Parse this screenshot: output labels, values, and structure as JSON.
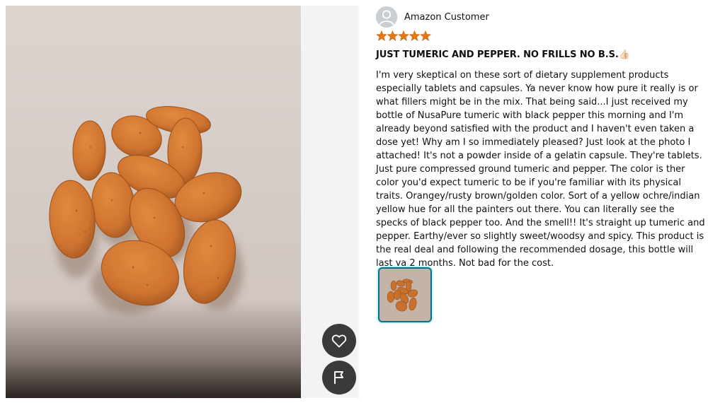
{
  "review": {
    "reviewer_name": "Amazon Customer",
    "rating": 5,
    "rating_max": 5,
    "title": "JUST TUMERIC AND PEPPER. NO FRILLS NO B.S.",
    "title_emoji": "👍🏻",
    "body": "I'm very skeptical on these sort of dietary supplement products especially tablets and capsules. Ya never know how pure it really is or what fillers might be in the mix. That being said...I just received my bottle of NusaPure tumeric with black pepper this morning and I'm already beyond satisfied with the product and I haven't even taken a dose yet! Why am I so immediately pleased? Just look at the photo I attached! It's not a powder inside of a gelatin capsule. They're tablets. Just pure compressed ground tumeric and pepper. The color is ther color you'd expect tumeric to be if you're familiar with its physical traits. Orangey/rusty brown/golden color. Sort of a yellow ochre/indian yellow hue for all the painters out there. You can literally see the specks of black pepper too. And the smell!! It's straight up tumeric and pepper. Earthy/ever so slightly sweet/woodsy and spicy. This product is the real deal and following the recommended dosage, this bottle will last ya 2 months. Not bad for the cost."
  },
  "actions": {
    "like_icon": "heart-outline-icon",
    "report_icon": "flag-icon"
  },
  "colors": {
    "star": "#e47911",
    "action_button_bg": "#3a3a3a",
    "thumbnail_border": "#007185",
    "tablet": "#d2792f"
  }
}
